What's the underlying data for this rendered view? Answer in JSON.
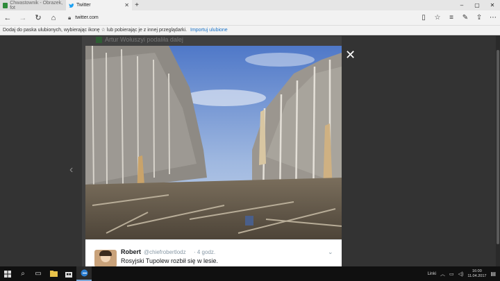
{
  "tabs": [
    {
      "title": "Chwastownik - Obrazek, fot",
      "active": false
    },
    {
      "title": "Twitter",
      "active": true
    }
  ],
  "new_tab": "+",
  "window_controls": {
    "minimize": "–",
    "maximize": "▢",
    "close": "✕"
  },
  "address": {
    "url": "twitter.com"
  },
  "favorites_bar": {
    "message": "Dodaj do paska ulubionych, wybierając ikonę ☆ lub pobierając je z innej przeglądarki.",
    "link": "Importuj ulubione"
  },
  "page": {
    "retweet_note": "Artur Wołuszyi podaliła dalej"
  },
  "tweet": {
    "name": "Robert",
    "handle": "@chiefrobertlodz",
    "time": "· 4 godz.",
    "text": "Rosyjski Tupolew rozbił się w lesie."
  },
  "taskbar": {
    "links_label": "Linki",
    "time": "16:00",
    "date": "11.04.2017"
  }
}
